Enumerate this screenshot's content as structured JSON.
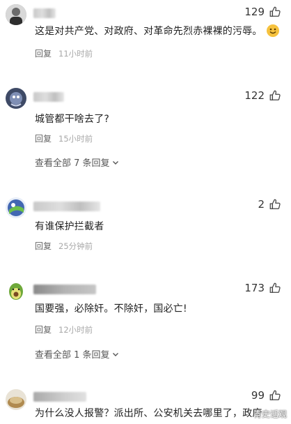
{
  "comments": [
    {
      "likes": "129",
      "text": "这是对共产党、对政府、对革命先烈赤裸裸的污辱。",
      "reply_label": "回复",
      "time": "11小时前"
    },
    {
      "likes": "122",
      "text": "城管都干啥去了?",
      "reply_label": "回复",
      "time": "15小时前",
      "expand_label": "查看全部 7 条回复"
    },
    {
      "likes": "2",
      "text": "有谁保护拦截者",
      "reply_label": "回复",
      "time": "25分钟前"
    },
    {
      "likes": "173",
      "text": "国要强，必除奸。不除奸，国必亡!",
      "reply_label": "回复",
      "time": "12小时前",
      "expand_label": "查看全部 1 条回复"
    },
    {
      "likes": "99",
      "text": "为什么没人报警？派出所、公安机关去哪里了，政府"
    }
  ],
  "watermark": "青史话观",
  "icons": {
    "like": "thumbs-up-outline-icon",
    "expand": "chevron-down-icon",
    "emoji": "smiling-face-emoji"
  }
}
